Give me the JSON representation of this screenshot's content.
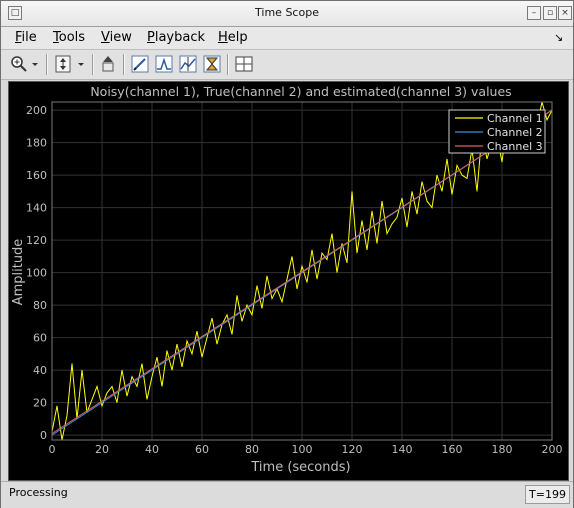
{
  "window": {
    "title": "Time Scope"
  },
  "menu": [
    {
      "label": "File",
      "accel": "F",
      "rest": "ile"
    },
    {
      "label": "Tools",
      "accel": "T",
      "rest": "ools"
    },
    {
      "label": "View",
      "accel": "V",
      "rest": "iew"
    },
    {
      "label": "Playback",
      "accel": "P",
      "rest": "layback"
    },
    {
      "label": "Help",
      "accel": "H",
      "rest": "elp"
    }
  ],
  "toolbar": {
    "icons": [
      "zoom-in-icon",
      "zoom-dropdown-icon",
      "scale-axes-icon",
      "restore-layout-icon",
      "style-icon",
      "triggers-icon",
      "cursor-measurements-icon",
      "signal-statistics-icon",
      "layout-icon"
    ]
  },
  "status": {
    "text": "Processing",
    "time": "T=199"
  },
  "colors": {
    "plot_bg": "#000000",
    "axes": "#999999",
    "channel1": "#ffff00",
    "channel2": "#3a8fd8",
    "channel3": "#e06060"
  },
  "chart_data": {
    "type": "line",
    "title": "Noisy(channel 1), True(channel 2) and estimated(channel 3) values",
    "xlabel": "Time (seconds)",
    "ylabel": "Amplitude",
    "xlim": [
      0,
      200
    ],
    "ylim": [
      -3,
      205
    ],
    "xticks": [
      0,
      20,
      40,
      60,
      80,
      100,
      120,
      140,
      160,
      180,
      200
    ],
    "yticks": [
      0,
      20,
      40,
      60,
      80,
      100,
      120,
      140,
      160,
      180,
      200
    ],
    "grid": true,
    "legend": "top-right",
    "series": [
      {
        "name": "Channel 1",
        "color": "#ffff00",
        "x": [
          0,
          2,
          4,
          6,
          8,
          10,
          12,
          14,
          16,
          18,
          20,
          22,
          24,
          26,
          28,
          30,
          32,
          34,
          36,
          38,
          40,
          42,
          44,
          46,
          48,
          50,
          52,
          54,
          56,
          58,
          60,
          62,
          64,
          66,
          68,
          70,
          72,
          74,
          76,
          78,
          80,
          82,
          84,
          86,
          88,
          90,
          92,
          94,
          96,
          98,
          100,
          102,
          104,
          106,
          108,
          110,
          112,
          114,
          116,
          118,
          120,
          122,
          124,
          126,
          128,
          130,
          132,
          134,
          136,
          138,
          140,
          142,
          144,
          146,
          148,
          150,
          152,
          154,
          156,
          158,
          160,
          162,
          164,
          166,
          168,
          170,
          172,
          174,
          176,
          178,
          180,
          182,
          184,
          186,
          188,
          190,
          192,
          194,
          196,
          198,
          200
        ],
        "values": [
          2,
          18,
          -3,
          12,
          44,
          10,
          40,
          14,
          22,
          30,
          18,
          26,
          30,
          20,
          40,
          24,
          36,
          30,
          44,
          22,
          36,
          48,
          30,
          52,
          40,
          56,
          42,
          58,
          50,
          64,
          48,
          60,
          72,
          56,
          68,
          74,
          62,
          86,
          70,
          80,
          74,
          92,
          78,
          98,
          84,
          90,
          82,
          96,
          110,
          90,
          104,
          94,
          114,
          96,
          112,
          108,
          124,
          100,
          118,
          106,
          150,
          112,
          132,
          114,
          138,
          118,
          144,
          124,
          130,
          134,
          146,
          128,
          150,
          136,
          156,
          144,
          140,
          160,
          150,
          170,
          148,
          166,
          160,
          158,
          176,
          150,
          186,
          170,
          180,
          184,
          168,
          192,
          178,
          186,
          196,
          184,
          200,
          190,
          205,
          194,
          200
        ]
      },
      {
        "name": "Channel 2",
        "color": "#3a8fd8",
        "x": [
          0,
          200
        ],
        "values": [
          0,
          200
        ]
      },
      {
        "name": "Channel 3",
        "color": "#e06060",
        "x": [
          0,
          200
        ],
        "values": [
          1,
          200
        ]
      }
    ]
  }
}
